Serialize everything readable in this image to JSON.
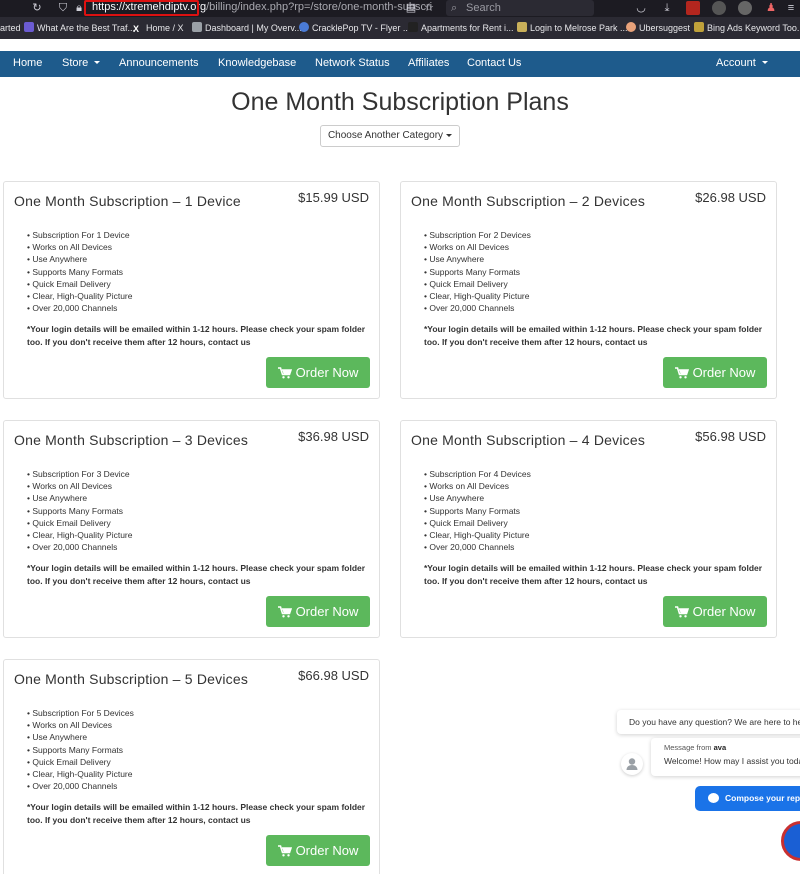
{
  "browser": {
    "url_domain": "https://xtremehdiptv.org",
    "url_rest": "/billing/index.php?rp=/store/one-month-subscri",
    "search_placeholder": "Search",
    "bookmarks": [
      "arted",
      "What Are the Best Traf...",
      "Home / X",
      "Dashboard | My Overv...",
      "CracklePop TV - Flyer ...",
      "Apartments for Rent i...",
      "Login to Melrose Park ...",
      "Ubersuggest",
      "Bing Ads Keyword Too..."
    ]
  },
  "nav": {
    "items": [
      "Home",
      "Store",
      "Announcements",
      "Knowledgebase",
      "Network Status",
      "Affiliates",
      "Contact Us"
    ],
    "account": "Account"
  },
  "page": {
    "title": "One Month Subscription Plans",
    "category_button": "Choose Another Category"
  },
  "products": [
    {
      "title": "One Month Subscription – 1 Device",
      "price": "$15.99 USD",
      "features": [
        "Subscription For 1 Device",
        "Works on All Devices",
        "Use Anywhere",
        "Supports Many Formats",
        "Quick Email Delivery",
        "Clear, High-Quality Picture",
        "Over 20,000 Channels"
      ],
      "note": "*Your login details will be emailed within 1-12 hours. Please check your spam folder too. If you don't receive them after 12 hours, contact us",
      "button": "Order Now"
    },
    {
      "title": "One Month Subscription – 2 Devices",
      "price": "$26.98 USD",
      "features": [
        "Subscription For 2 Devices",
        "Works on All Devices",
        "Use Anywhere",
        "Supports Many Formats",
        "Quick Email Delivery",
        "Clear, High-Quality Picture",
        "Over 20,000 Channels"
      ],
      "note": "*Your login details will be emailed within 1-12 hours. Please check your spam folder too. If you don't receive them after 12 hours, contact us",
      "button": "Order Now"
    },
    {
      "title": "One Month Subscription – 3 Devices",
      "price": "$36.98 USD",
      "features": [
        "Subscription For 3 Device",
        "Works on All Devices",
        "Use Anywhere",
        "Supports Many Formats",
        "Quick Email Delivery",
        "Clear, High-Quality Picture",
        "Over 20,000 Channels"
      ],
      "note": "*Your login details will be emailed within 1-12 hours. Please check your spam folder too. If you don't receive them after 12 hours, contact us",
      "button": "Order Now"
    },
    {
      "title": "One Month Subscription – 4 Devices",
      "price": "$56.98 USD",
      "features": [
        "Subscription For 4 Devices",
        "Works on All Devices",
        "Use Anywhere",
        "Supports Many Formats",
        "Quick Email Delivery",
        "Clear, High-Quality Picture",
        "Over 20,000 Channels"
      ],
      "note": "*Your login details will be emailed within 1-12 hours. Please check your spam folder too. If you don't receive them after 12 hours, contact us",
      "button": "Order Now"
    },
    {
      "title": "One Month Subscription – 5 Devices",
      "price": "$66.98 USD",
      "features": [
        "Subscription For 5 Devices",
        "Works on All Devices",
        "Use Anywhere",
        "Supports Many Formats",
        "Quick Email Delivery",
        "Clear, High-Quality Picture",
        "Over 20,000 Channels"
      ],
      "note": "*Your login details will be emailed within 1-12 hours. Please check your spam folder too. If you don't receive them after 12 hours, contact us",
      "button": "Order Now"
    }
  ],
  "chat": {
    "question": "Do you have any question? We are here to he",
    "message_from_label": "Message from",
    "agent_name": "ava",
    "message": "Welcome! How may I assist you toda",
    "compose": "Compose your rep"
  },
  "colors": {
    "nav_bg": "#1e5b8c",
    "order_button": "#5cb85c",
    "chat_blue": "#1a73e8",
    "url_highlight": "#dd1111"
  }
}
